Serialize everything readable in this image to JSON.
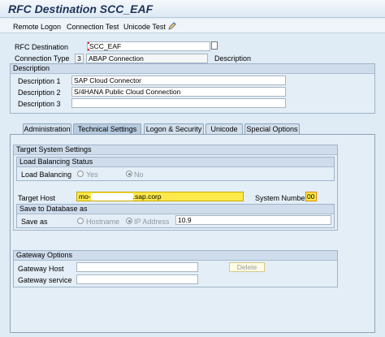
{
  "window": {
    "title": "RFC Destination SCC_EAF"
  },
  "toolbar": {
    "remote_logon": "Remote Logon",
    "connection_test": "Connection Test",
    "unicode_test": "Unicode Test"
  },
  "header": {
    "rfc_destination_label": "RFC Destination",
    "rfc_destination_value": "SCC_EAF",
    "connection_type_label": "Connection Type",
    "connection_type_code": "3",
    "connection_type_text": "ABAP Connection",
    "description_label": "Description"
  },
  "description": {
    "section_title": "Description",
    "rows": [
      {
        "label": "Description 1",
        "value": "SAP Cloud Connector"
      },
      {
        "label": "Description 2",
        "value": "S/4HANA Public Cloud Connection"
      },
      {
        "label": "Description 3",
        "value": ""
      }
    ]
  },
  "tabs": [
    {
      "label": "Administration"
    },
    {
      "label": "Technical Settings"
    },
    {
      "label": "Logon & Security"
    },
    {
      "label": "Unicode"
    },
    {
      "label": "Special Options"
    }
  ],
  "target_system": {
    "title": "Target System Settings",
    "load_balancing_status_title": "Load Balancing Status",
    "load_balancing_label": "Load Balancing",
    "yes": "Yes",
    "no": "No",
    "target_host_label": "Target Host",
    "target_host_prefix": "mo-",
    "target_host_suffix": ".sap.corp",
    "system_number_label": "System Number",
    "system_number_value": "00",
    "save_as_title": "Save to Database as",
    "save_as_label": "Save as",
    "hostname": "Hostname",
    "ip_address": "IP Address",
    "ip_value": "10.9"
  },
  "gateway": {
    "title": "Gateway Options",
    "host_label": "Gateway Host",
    "service_label": "Gateway service",
    "delete_label": "Delete"
  },
  "colors": {
    "accent_title": "#1e3358",
    "required_field": "#fde94a",
    "required_marker": "#e0212b"
  }
}
